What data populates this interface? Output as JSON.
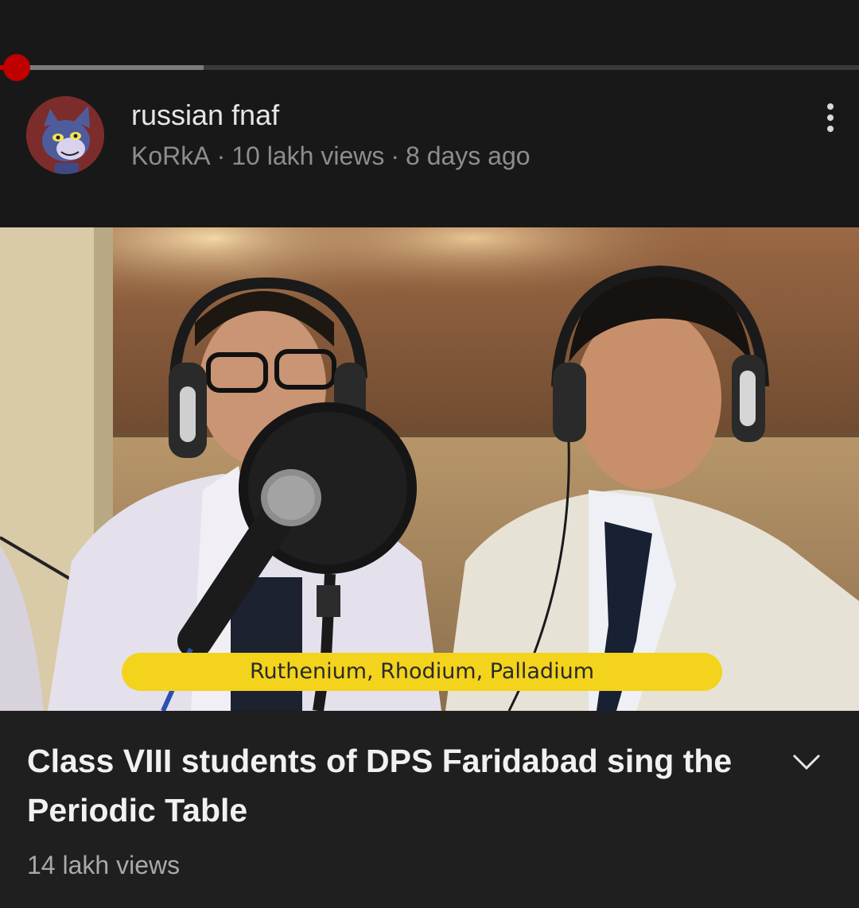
{
  "player": {
    "progress_buffered": 0.237,
    "progress_played": 0.02,
    "accent_color": "#cc0000"
  },
  "previous_video": {
    "title": "russian fnaf",
    "channel": "KoRkA",
    "views": "10 lakh views",
    "age": "8 days ago",
    "separator": "·",
    "avatar_icon": "cartoon-cat-avatar",
    "menu_icon": "more-vert-icon"
  },
  "current_video": {
    "thumbnail_caption": "Ruthenium, Rhodium, Palladium",
    "title": "Class VIII students of DPS Faridabad sing the Periodic Table",
    "views": "14 lakh views",
    "expand_icon": "chevron-down-icon"
  }
}
